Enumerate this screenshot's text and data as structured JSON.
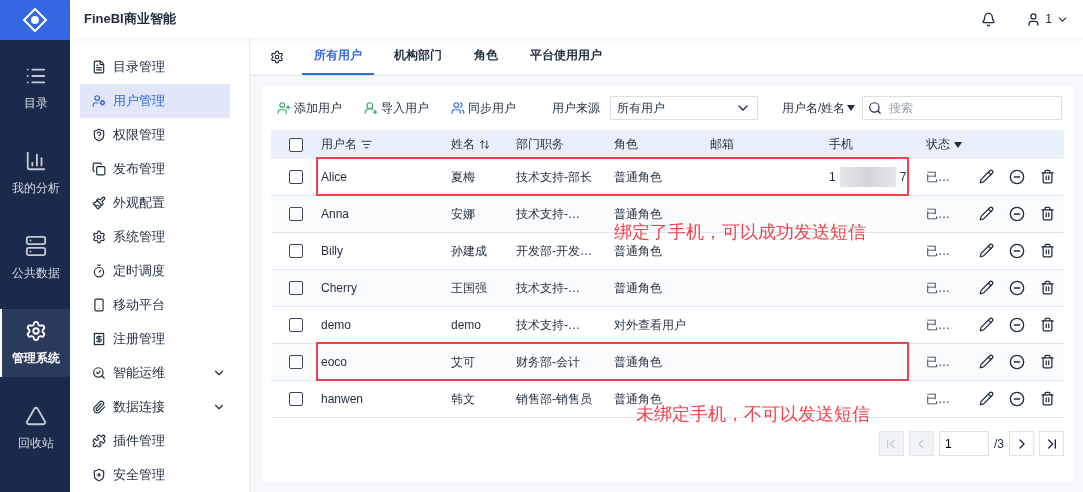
{
  "header": {
    "title": "FineBI商业智能",
    "user": "1"
  },
  "rail": [
    {
      "label": "目录",
      "selected": false
    },
    {
      "label": "我的分析",
      "selected": false
    },
    {
      "label": "公共数据",
      "selected": false
    },
    {
      "label": "管理系统",
      "selected": true
    },
    {
      "label": "回收站",
      "selected": false
    }
  ],
  "sidebar": [
    {
      "label": "目录管理",
      "selected": false,
      "expandable": false
    },
    {
      "label": "用户管理",
      "selected": true,
      "expandable": false
    },
    {
      "label": "权限管理",
      "selected": false,
      "expandable": false
    },
    {
      "label": "发布管理",
      "selected": false,
      "expandable": false
    },
    {
      "label": "外观配置",
      "selected": false,
      "expandable": false
    },
    {
      "label": "系统管理",
      "selected": false,
      "expandable": false
    },
    {
      "label": "定时调度",
      "selected": false,
      "expandable": false
    },
    {
      "label": "移动平台",
      "selected": false,
      "expandable": false
    },
    {
      "label": "注册管理",
      "selected": false,
      "expandable": false
    },
    {
      "label": "智能运维",
      "selected": false,
      "expandable": true
    },
    {
      "label": "数据连接",
      "selected": false,
      "expandable": true
    },
    {
      "label": "插件管理",
      "selected": false,
      "expandable": false
    },
    {
      "label": "安全管理",
      "selected": false,
      "expandable": false
    }
  ],
  "tabs": [
    {
      "label": "所有用户",
      "selected": true
    },
    {
      "label": "机构部门",
      "selected": false
    },
    {
      "label": "角色",
      "selected": false
    },
    {
      "label": "平台使用用户",
      "selected": false
    }
  ],
  "toolbar": {
    "actions": [
      "添加用户",
      "导入用户",
      "同步用户"
    ],
    "source_label": "用户来源",
    "source_value": "所有用户",
    "search_scope": "用户名/姓名",
    "search_placeholder": "搜索"
  },
  "table": {
    "all_checked": false,
    "columns": [
      {
        "label": "用户名",
        "kind": "sort-filter"
      },
      {
        "label": "姓名",
        "kind": "sort"
      },
      {
        "label": "部门职务",
        "kind": "plain"
      },
      {
        "label": "角色",
        "kind": "plain"
      },
      {
        "label": "邮箱",
        "kind": "plain"
      },
      {
        "label": "手机",
        "kind": "plain"
      },
      {
        "label": "状态",
        "kind": "dropdown"
      }
    ],
    "rows": [
      {
        "username": "Alice",
        "name": "夏梅",
        "department": "技术支持-部长",
        "role": "普通角色",
        "phone": [
          "1",
          "7"
        ],
        "status": "已…",
        "checked": false,
        "outlined": true
      },
      {
        "username": "Anna",
        "name": "安娜",
        "department": "技术支持-…",
        "role": "普通角色",
        "status": "已…",
        "checked": false,
        "outlined": false
      },
      {
        "username": "Billy",
        "name": "孙建成",
        "department": "开发部-开发…",
        "role": "普通角色",
        "status": "已…",
        "checked": false,
        "outlined": false
      },
      {
        "username": "Cherry",
        "name": "王国强",
        "department": "技术支持-…",
        "role": "普通角色",
        "status": "已…",
        "checked": false,
        "outlined": false
      },
      {
        "username": "demo",
        "name": "demo",
        "department": "技术支持-…",
        "role": "对外查看用户",
        "status": "已…",
        "checked": false,
        "outlined": false
      },
      {
        "username": "eoco",
        "name": "艾可",
        "department": "财务部-会计",
        "role": "普通角色",
        "status": "已…",
        "checked": false,
        "outlined": true
      },
      {
        "username": "hanwen",
        "name": "韩文",
        "department": "销售部-销售员",
        "role": "普通角色",
        "status": "已…",
        "checked": false,
        "outlined": false
      }
    ]
  },
  "annotations": [
    "绑定了手机，可以成功发送短信",
    "未绑定手机，不可以发送短信"
  ],
  "pagination": {
    "page": "1",
    "total": "/3",
    "first_disabled": true,
    "prev_disabled": true,
    "next_disabled": false,
    "last_disabled": false
  }
}
